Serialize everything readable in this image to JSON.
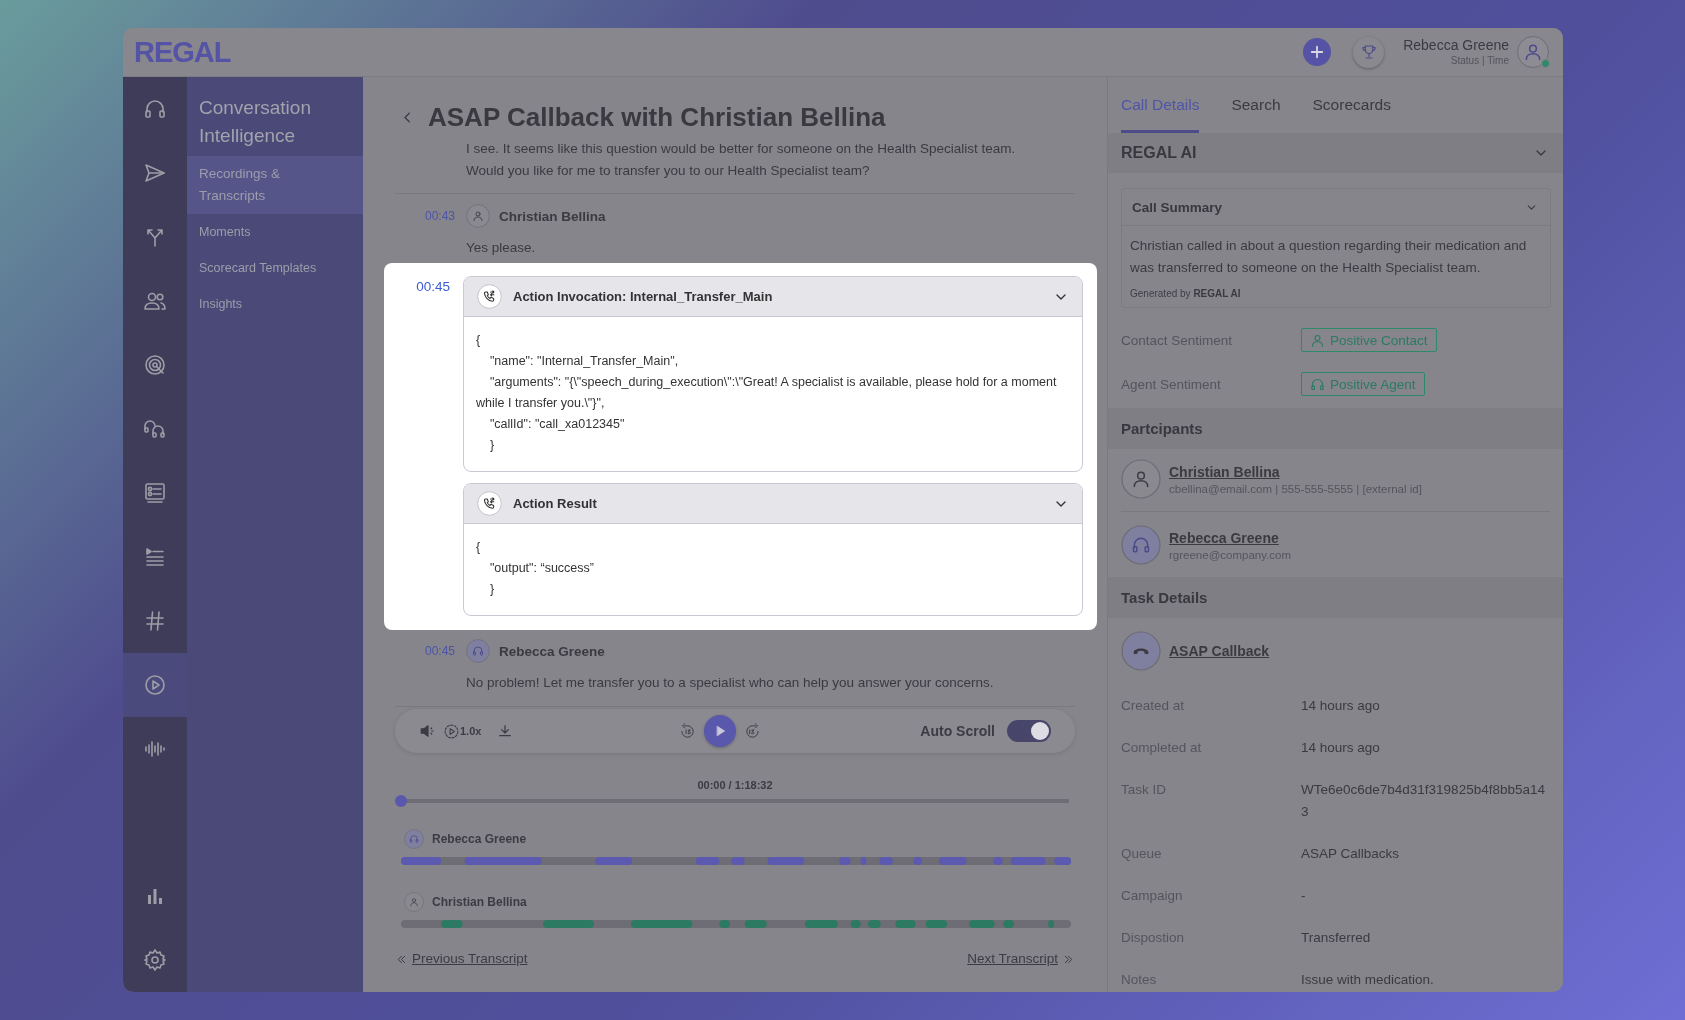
{
  "app": {
    "logo": "REGAL"
  },
  "header": {
    "user_name": "Rebecca Greene",
    "user_status": "Status | Time",
    "online": true
  },
  "rail": {
    "items": [
      {
        "selected": false
      },
      {
        "selected": false
      },
      {
        "selected": false
      },
      {
        "selected": false
      },
      {
        "selected": false
      },
      {
        "selected": false
      },
      {
        "selected": false
      },
      {
        "selected": false
      },
      {
        "selected": false
      },
      {
        "selected": true
      },
      {
        "selected": false
      }
    ],
    "bottom_items": [
      {
        "selected": false
      },
      {
        "selected": false
      }
    ]
  },
  "nav": {
    "title": "Conversation Intelligence",
    "items": [
      {
        "label": "Recordings & Transcripts",
        "selected": true
      },
      {
        "label": "Moments",
        "selected": false
      },
      {
        "label": "Scorecard Templates",
        "selected": false
      },
      {
        "label": "Insights",
        "selected": false
      }
    ]
  },
  "transcript": {
    "title": "ASAP Callback with Christian Bellina",
    "entries": [
      {
        "kind": "text",
        "lines": [
          "I see. It seems like this question would be better for someone on the Health Specialist team.",
          "Would you like for me to transfer you to our Health Specialist team?"
        ]
      },
      {
        "kind": "message",
        "time": "00:43",
        "speaker": {
          "name": "Christian Bellina",
          "kind": "contact"
        },
        "text": "Yes please."
      },
      {
        "kind": "actions",
        "time": "00:45",
        "highlighted": true,
        "panels": [
          {
            "title": "Action Invocation: Internal_Transfer_Main",
            "expanded": true,
            "code": "{\n    \"name\": \"Internal_Transfer_Main\",\n    \"arguments\": \"{\\\"speech_during_execution\\\":\\\"Great! A specialist is available, please hold for a moment while I transfer you.\\\"}\",\n    \"callId\": \"call_xa012345\"\n    }"
          },
          {
            "title": "Action Result",
            "expanded": true,
            "code": "{\n    \"output\": “success”\n    }"
          }
        ]
      },
      {
        "kind": "message",
        "time": "00:45",
        "speaker": {
          "name": "Rebecca Greene",
          "kind": "agent"
        },
        "text": "No problem! Let me transfer you to a specialist who can help you answer your concerns."
      }
    ]
  },
  "player": {
    "speed": "1.0x",
    "auto_scroll_label": "Auto Scroll",
    "auto_scroll": true,
    "time": "00:00 / 1:18:32",
    "level": 0,
    "tracks": [
      {
        "speaker": "Rebecca Greene",
        "kind": "agent",
        "color": "#5b59b0"
      },
      {
        "speaker": "Christian Bellina",
        "kind": "contact",
        "color": "#2d7a62"
      }
    ]
  },
  "pager": {
    "previous": "Previous Transcript",
    "next": "Next Transcript"
  },
  "details": {
    "tabs": [
      {
        "label": "Call Details",
        "selected": true
      },
      {
        "label": "Search",
        "selected": false
      },
      {
        "label": "Scorecards",
        "selected": false
      }
    ],
    "ai_section": {
      "title": "REGAL AI",
      "expanded": true,
      "summary": {
        "title": "Call Summary",
        "expanded": true,
        "text": "Christian called in about a question regarding their medication and was transferred to someone on the Health Specialist team.",
        "credit": "Generated by **REGAL AI**"
      },
      "sentiments": [
        {
          "label": "Contact Sentiment",
          "value": "Positive Contact",
          "kind": "contact"
        },
        {
          "label": "Agent Sentiment",
          "value": "Positive Agent",
          "kind": "agent"
        }
      ]
    },
    "participants": {
      "title": "Partcipants",
      "items": [
        {
          "name": "Christian Bellina",
          "detail": "cbellina@email.com | 555-555-5555 | [external id]",
          "kind": "contact"
        },
        {
          "name": "Rebecca Greene",
          "detail": "rgreene@company.com",
          "kind": "agent"
        }
      ]
    },
    "task": {
      "title": "Task Details",
      "name": "ASAP Callback",
      "fields": [
        {
          "label": "Created at",
          "value": "14 hours ago"
        },
        {
          "label": "Completed at",
          "value": "14 hours ago"
        },
        {
          "label": "Task ID",
          "value": "WTe6e0c6de7b4d31f319825b4f8bb5a143"
        },
        {
          "label": "Queue",
          "value": "ASAP Callbacks"
        },
        {
          "label": "Campaign",
          "value": "-"
        },
        {
          "label": "Dispostion",
          "value": "Transferred"
        },
        {
          "label": "Notes",
          "value": "Issue with medication."
        }
      ]
    }
  }
}
